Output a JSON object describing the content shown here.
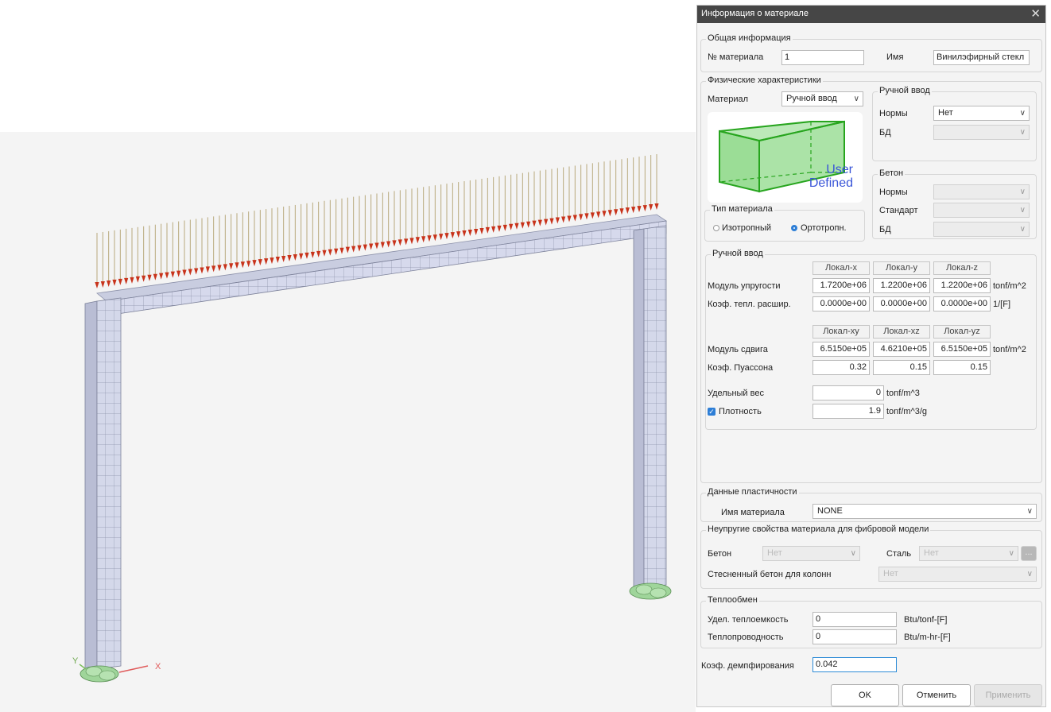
{
  "viewport": {
    "axis_x": "X",
    "axis_y": "Y"
  },
  "dialog": {
    "title": "Информация о материале",
    "general": {
      "title": "Общая информация",
      "number_label": "№ материала",
      "number_value": "1",
      "name_label": "Имя",
      "name_value": "Винилэфирный стекл"
    },
    "physical": {
      "title": "Физические характеристики",
      "material_label": "Материал",
      "material_value": "Ручной ввод",
      "preview_text_1": "User",
      "preview_text_2": "Defined",
      "type_title": "Тип материала",
      "isotropic": "Изотропный",
      "orthotropic": "Ортотропн.",
      "manual_group": {
        "title": "Ручной ввод",
        "norms_label": "Нормы",
        "norms_value": "Нет",
        "db_label": "БД"
      },
      "concrete_group": {
        "title": "Бетон",
        "norms_label": "Нормы",
        "standard_label": "Стандарт",
        "db_label": "БД"
      },
      "manual_input": {
        "title": "Ручной ввод",
        "headers1": [
          "Локал-x",
          "Локал-y",
          "Локал-z"
        ],
        "modulus_label": "Модуль упругости",
        "modulus": [
          "1.7200e+06",
          "1.2200e+06",
          "1.2200e+06"
        ],
        "modulus_unit": "tonf/m^2",
        "thermal_label": "Коэф. тепл. расшир.",
        "thermal": [
          "0.0000e+00",
          "0.0000e+00",
          "0.0000e+00"
        ],
        "thermal_unit": "1/[F]",
        "headers2": [
          "Локал-xy",
          "Локал-xz",
          "Локал-yz"
        ],
        "shear_label": "Модуль сдвига",
        "shear": [
          "6.5150e+05",
          "4.6210e+05",
          "6.5150e+05"
        ],
        "shear_unit": "tonf/m^2",
        "poisson_label": "Коэф. Пуассона",
        "poisson": [
          "0.32",
          "0.15",
          "0.15"
        ],
        "weight_label": "Удельный вес",
        "weight": "0",
        "weight_unit": "tonf/m^3",
        "density_label": "Плотность",
        "density": "1.9",
        "density_unit": "tonf/m^3/g"
      }
    },
    "plasticity": {
      "title": "Данные пластичности",
      "name_label": "Имя материала",
      "name_value": "NONE"
    },
    "fiber": {
      "title": "Неупругие свойства материала для фибровой модели",
      "concrete_label": "Бетон",
      "concrete_value": "Нет",
      "steel_label": "Сталь",
      "steel_value": "Нет",
      "confined_label": "Стесненный бетон для колонн",
      "confined_value": "Нет",
      "more_button": "..."
    },
    "heat": {
      "title": "Теплообмен",
      "capacity_label": "Удел. теплоемкость",
      "capacity_value": "0",
      "capacity_unit": "Btu/tonf-[F]",
      "conductivity_label": "Теплопроводность",
      "conductivity_value": "0",
      "conductivity_unit": "Btu/m-hr-[F]"
    },
    "damping_label": "Коэф. демпфирования",
    "damping_value": "0.042",
    "buttons": {
      "ok": "OK",
      "cancel": "Отменить",
      "apply": "Применить"
    }
  }
}
